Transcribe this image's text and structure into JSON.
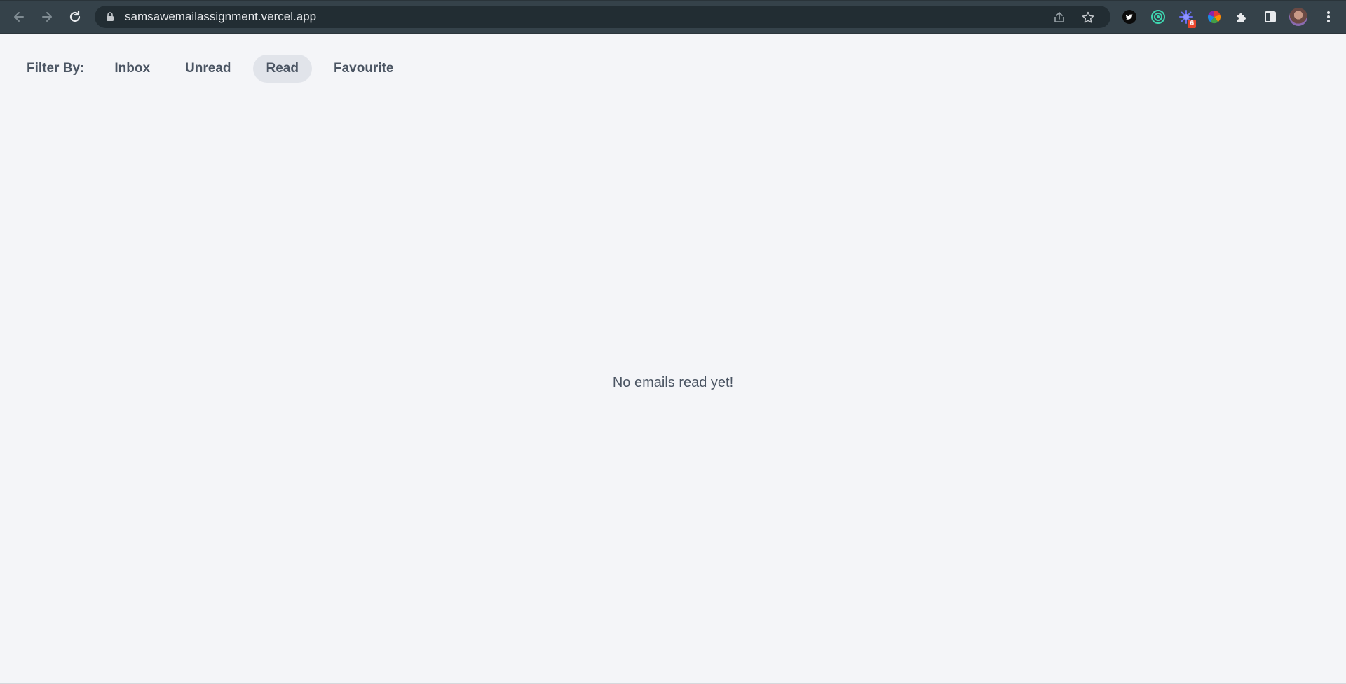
{
  "browser": {
    "url": "samsawemailassignment.vercel.app",
    "extension_badge": "6"
  },
  "filters": {
    "label": "Filter By:",
    "items": [
      "Inbox",
      "Unread",
      "Read",
      "Favourite"
    ],
    "active": "Read"
  },
  "empty_state": {
    "message": "No emails read yet!"
  },
  "icons": {
    "back": "back-arrow-icon",
    "forward": "forward-arrow-icon",
    "reload": "reload-icon",
    "lock": "lock-icon",
    "share": "share-icon",
    "bookmark": "star-icon",
    "extensions": [
      "twitter-icon",
      "circle-target-icon",
      "puzzle-burst-icon",
      "color-wheel-icon",
      "puzzle-icon",
      "side-panel-icon"
    ],
    "menu": "kebab-menu-icon"
  },
  "colors": {
    "browser_bar": "#35424a",
    "page_background": "#f4f5f8",
    "active_filter_background": "#e1e4ea",
    "text": "#4b5563"
  }
}
